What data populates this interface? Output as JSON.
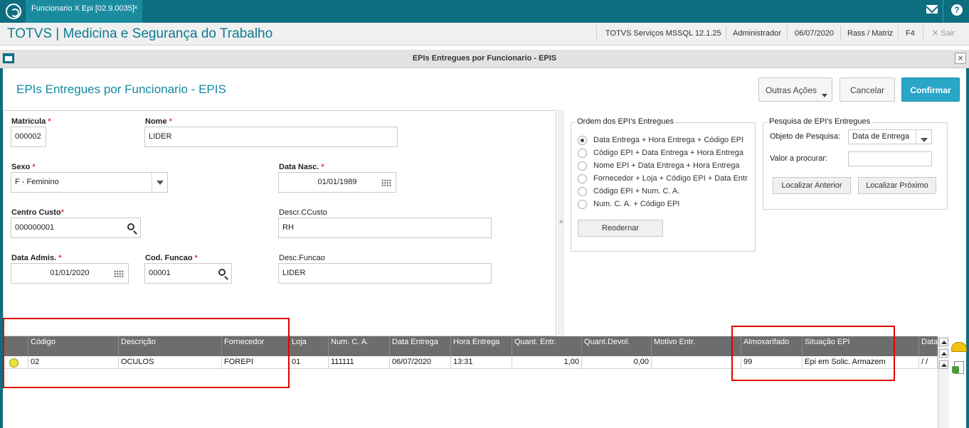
{
  "window": {
    "tab_title": "Funcionario X Epi [02.9.0035]",
    "tab_close": "×"
  },
  "header": {
    "app_title": "TOTVS | Medicina e Segurança do Trabalho",
    "server": "TOTVS Serviços MSSQL 12.1.25",
    "user": "Administrador",
    "date": "06/07/2020",
    "branch": "Rass / Matriz",
    "shortcut": "F4",
    "exit": "✕  Sair",
    "help": "?"
  },
  "dialog": {
    "title": "EPIs Entregues por Funcionario - EPIS",
    "close": "×",
    "form_title": "EPIs Entregues por Funcionario - EPIS",
    "buttons": {
      "more_actions": "Outras Ações",
      "cancel": "Cancelar",
      "confirm": "Confirmar"
    }
  },
  "form": {
    "matricula": {
      "label": "Matricula",
      "value": "000002"
    },
    "nome": {
      "label": "Nome",
      "value": "LIDER"
    },
    "sexo": {
      "label": "Sexo",
      "value": "F - Feminino"
    },
    "data_nasc": {
      "label": "Data Nasc.",
      "value": "01/01/1989"
    },
    "centro_custo": {
      "label": "Centro Custo",
      "value": "000000001"
    },
    "descr_ccusto": {
      "label": "Descr.CCusto",
      "value": "RH"
    },
    "data_admis": {
      "label": "Data Admis.",
      "value": "01/01/2020"
    },
    "cod_funcao": {
      "label": "Cod. Funcao",
      "value": "00001"
    },
    "desc_funcao": {
      "label": "Desc.Funcao",
      "value": "LIDER"
    },
    "required_mark": "*"
  },
  "splitter": {
    "arrow": ">"
  },
  "order_group": {
    "title": "Ordem dos EPI's Entregues",
    "options": [
      {
        "label": "Data Entrega + Hora Entrega + Código EPI",
        "selected": true
      },
      {
        "label": "Código EPI + Data Entrega + Hora Entrega",
        "selected": false
      },
      {
        "label": "Nome EPI + Data Entrega + Hora Entrega",
        "selected": false
      },
      {
        "label": "Fornecedor + Loja + Código EPI + Data Entr",
        "selected": false
      },
      {
        "label": "Código EPI +  Num. C. A.",
        "selected": false
      },
      {
        "label": "Num. C. A. + Código EPI",
        "selected": false
      }
    ],
    "reorder_button": "Reodernar"
  },
  "search_group": {
    "title": "Pesquisa de EPI's Entregues",
    "object_label": "Objeto de Pesquisa:",
    "object_value": "Data de Entrega",
    "value_label": "Valor a procurar:",
    "value": "",
    "prev_button": "Localizar Anterior",
    "next_button": "Localizar Próximo"
  },
  "grid": {
    "columns": [
      "",
      "Código",
      "Descrição",
      "Fornecedor",
      "Loja",
      "Num. C. A.",
      "Data Entrega",
      "Hora Entrega",
      "Quant. Entr.",
      "Quant.Devol.",
      "Motivo Entr.",
      "Almoxarifado",
      "Situação EPI",
      "Data"
    ],
    "rows": [
      [
        "",
        "02",
        "OCULOS",
        "FOREPI",
        "01",
        "111111",
        "06/07/2020",
        "13:31",
        "1,00",
        "0,00",
        "",
        "99",
        "Epi em Solic. Armazem",
        " /  /"
      ]
    ]
  },
  "colors": {
    "brand": "#0d6e80",
    "accent": "#2aa6c6",
    "highlight_box": "#e00000",
    "status_dot": "#e8e23a"
  },
  "icons": [
    "totvs-logo-icon",
    "mail-icon",
    "help-icon",
    "window-icon",
    "search-icon",
    "calendar-icon",
    "helmet-icon",
    "document-icon"
  ]
}
